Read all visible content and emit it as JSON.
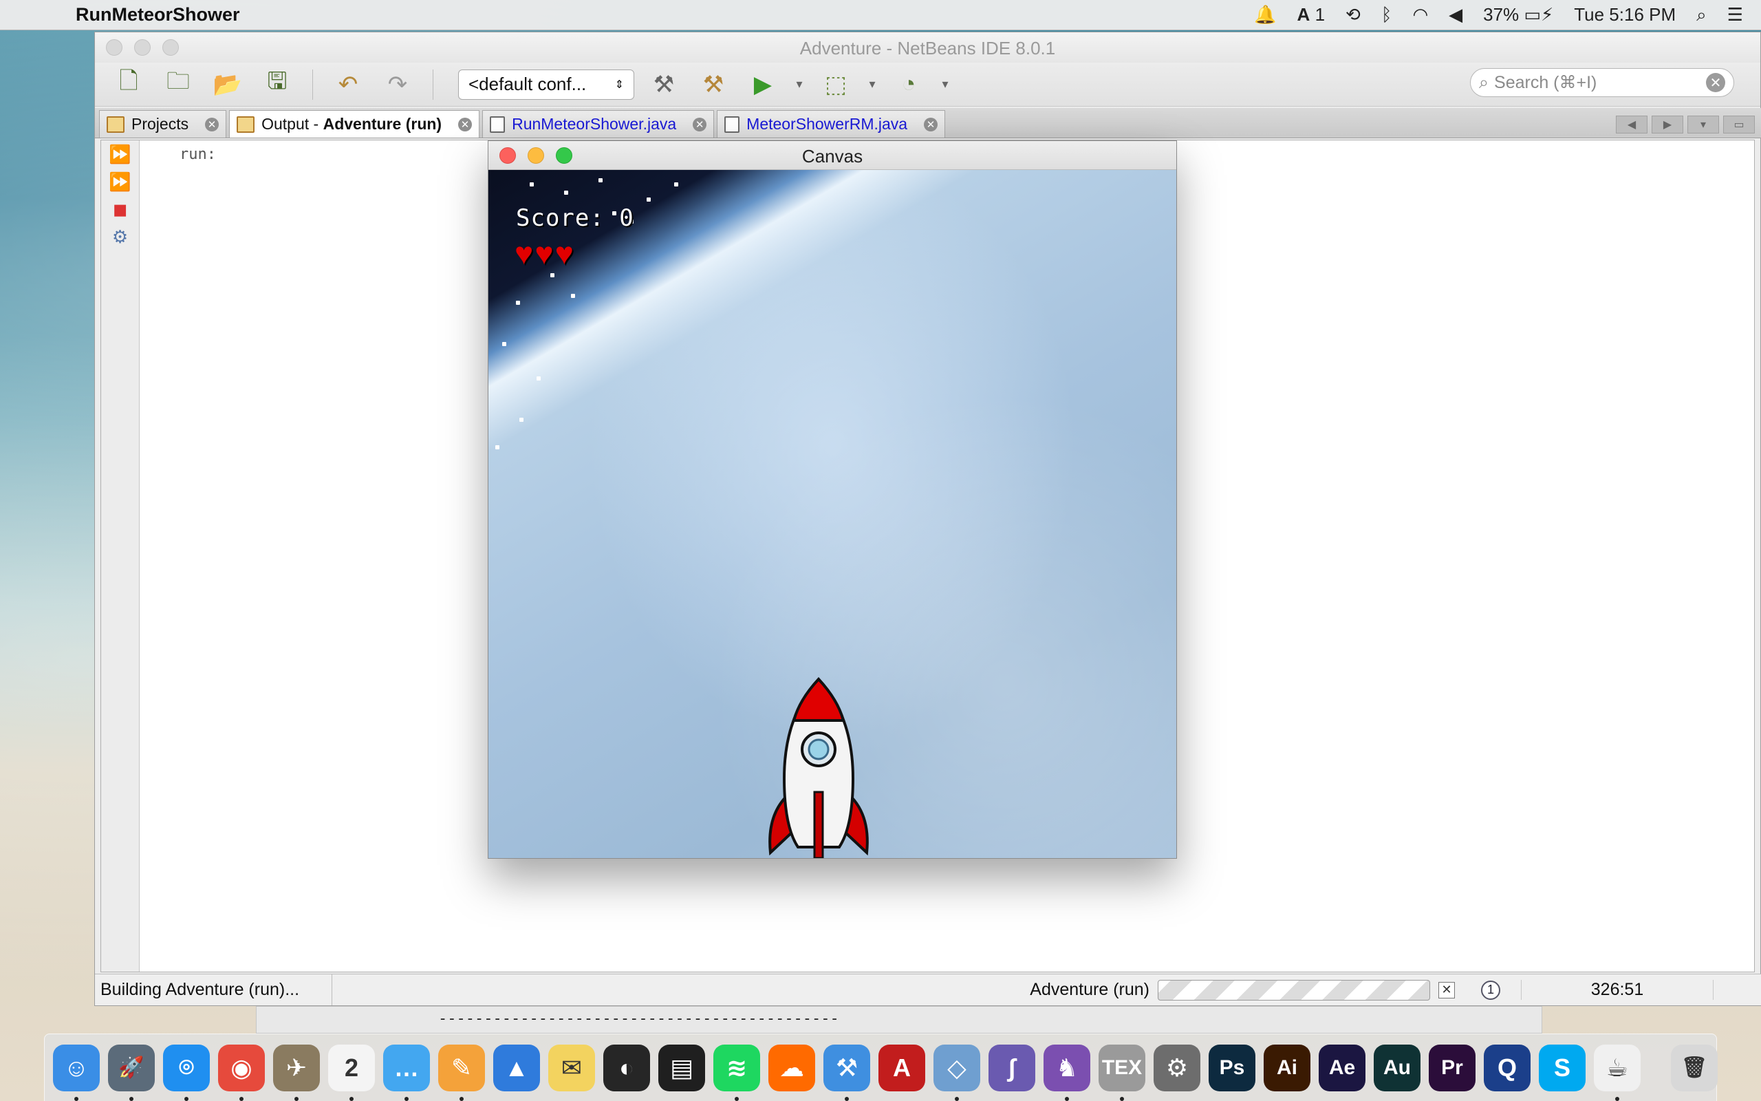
{
  "menubar": {
    "app_name": "RunMeteorShower",
    "adobe_badge": "1",
    "battery": "37%",
    "clock": "Tue 5:16 PM"
  },
  "ide": {
    "window_title": "Adventure - NetBeans IDE 8.0.1",
    "config_select": "<default conf...",
    "search_placeholder": "Search (⌘+I)",
    "tabs": [
      {
        "label": "Projects",
        "kind": "panel"
      },
      {
        "label": "Output - ",
        "bold": "Adventure (run)",
        "kind": "panel",
        "active": true
      },
      {
        "label": "RunMeteorShower.java",
        "kind": "java"
      },
      {
        "label": "MeteorShowerRM.java",
        "kind": "java"
      }
    ],
    "output_text": "run:",
    "status": {
      "left": "Building Adventure (run)...",
      "task": "Adventure (run)",
      "notifications": "1",
      "caret": "326:51"
    }
  },
  "canvas": {
    "title": "Canvas",
    "score_text": "Score: 0",
    "lives": 3
  },
  "background": {
    "dashes": "--------------------------------------------"
  },
  "dock": {
    "apps": [
      {
        "name": "finder",
        "glyph": "☺",
        "color": "#3a8ee6"
      },
      {
        "name": "launchpad",
        "glyph": "🚀",
        "color": "#5b6b7a"
      },
      {
        "name": "safari",
        "glyph": "⌾",
        "color": "#1f8ff0"
      },
      {
        "name": "chrome",
        "glyph": "◉",
        "color": "#e64a3c"
      },
      {
        "name": "preview",
        "glyph": "✈",
        "color": "#8a7b60"
      },
      {
        "name": "calendar",
        "glyph": "2",
        "color": "#f4f4f4"
      },
      {
        "name": "messages",
        "glyph": "…",
        "color": "#43a7f0"
      },
      {
        "name": "pages",
        "glyph": "✎",
        "color": "#f4a23a"
      },
      {
        "name": "keynote",
        "glyph": "▲",
        "color": "#2f7bdc"
      },
      {
        "name": "stickies",
        "glyph": "✉",
        "color": "#f3d35f"
      },
      {
        "name": "dashboard",
        "glyph": "◐",
        "color": "#262626"
      },
      {
        "name": "photo-booth",
        "glyph": "▤",
        "color": "#1f1f1f"
      },
      {
        "name": "spotify",
        "glyph": "≋",
        "color": "#1ed760"
      },
      {
        "name": "soundcloud",
        "glyph": "☁",
        "color": "#ff6a00"
      },
      {
        "name": "xcode",
        "glyph": "⚒",
        "color": "#3f8fe0"
      },
      {
        "name": "adobe-reader",
        "glyph": "A",
        "color": "#c21d1d"
      },
      {
        "name": "virtualbox",
        "glyph": "◇",
        "color": "#6f9fd0"
      },
      {
        "name": "emacs",
        "glyph": "∫",
        "color": "#6a5ab0"
      },
      {
        "name": "github",
        "glyph": "♞",
        "color": "#7b4fb0"
      },
      {
        "name": "tex-shop",
        "glyph": "TEX",
        "color": "#9a9a9a"
      },
      {
        "name": "system-preferences",
        "glyph": "⚙",
        "color": "#6d6d6d"
      },
      {
        "name": "photoshop",
        "glyph": "Ps",
        "color": "#0d2a3f"
      },
      {
        "name": "illustrator",
        "glyph": "Ai",
        "color": "#3a1a02"
      },
      {
        "name": "after-effects",
        "glyph": "Ae",
        "color": "#1b1641"
      },
      {
        "name": "audition",
        "glyph": "Au",
        "color": "#0f3234"
      },
      {
        "name": "premiere",
        "glyph": "Pr",
        "color": "#2b0d3a"
      },
      {
        "name": "quicktime",
        "glyph": "Q",
        "color": "#1b3f8a"
      },
      {
        "name": "skype",
        "glyph": "S",
        "color": "#00a9f0"
      },
      {
        "name": "java",
        "glyph": "☕",
        "color": "#f0f0f0"
      },
      {
        "name": "trash",
        "glyph": "🗑",
        "color": "#d8d8d8"
      }
    ]
  }
}
